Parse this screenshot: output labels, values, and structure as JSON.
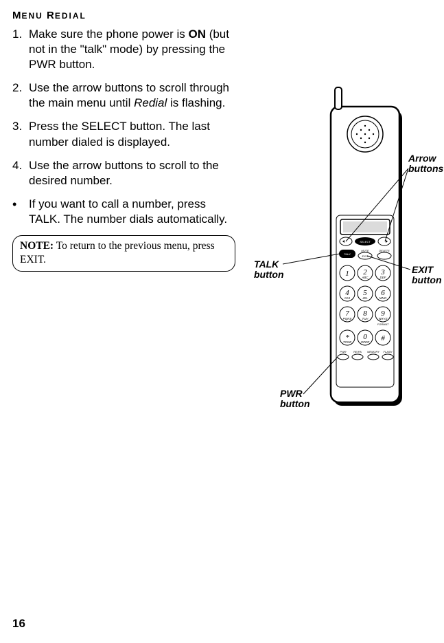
{
  "title_part1": "M",
  "title_part2": "ENU",
  "title_part3": " R",
  "title_part4": "EDIAL",
  "steps": [
    {
      "n": "1.",
      "pre": "Make sure the phone power is ",
      "bold": "ON",
      "post": " (but not in the \"talk\" mode) by pressing the PWR button."
    },
    {
      "n": "2.",
      "pre": "Use the arrow buttons to scroll through the main menu until ",
      "italic": "Redial",
      "post": " is flashing."
    },
    {
      "n": "3.",
      "pre": "Press the SELECT button. The last number dialed is displayed.",
      "bold": "",
      "post": ""
    },
    {
      "n": "4.",
      "pre": "Use the arrow buttons to scroll to the desired number.",
      "bold": "",
      "post": ""
    }
  ],
  "bullet": {
    "mark": "•",
    "text": "If you want to call a number, press TALK. The number dials automatically."
  },
  "note": {
    "label": "NOTE:",
    "text": " To return to the previous menu, press EXIT."
  },
  "page": "16",
  "callouts": {
    "arrow": "Arrow buttons",
    "talk": "TALK button",
    "exit": "EXIT button",
    "pwr": "PWR button"
  },
  "keys": {
    "select": "SELECT",
    "talk": "TALK",
    "mute": "MUTE",
    "exit": "EXIT",
    "delete": "DELETE",
    "k1": "1",
    "k2": "2",
    "k2s": "ABC",
    "k3": "3",
    "k3s": "DEF",
    "k4": "4",
    "k4s": "GHI",
    "k5": "5",
    "k5s": "JKL",
    "k6": "6",
    "k6s": "MNO",
    "k7": "7",
    "k7s": "PQRS",
    "k8": "8",
    "k8s": "TUV",
    "k9": "9",
    "k9s": "WXYZ",
    "kstar": "*",
    "kstars": "TONE",
    "k0": "0",
    "k0s": "OPER",
    "khash": "#",
    "format": "FORMAT",
    "pwr": "PWR",
    "repa": "RE/PA",
    "memory": "MEMORY",
    "flash": "FLASH"
  }
}
